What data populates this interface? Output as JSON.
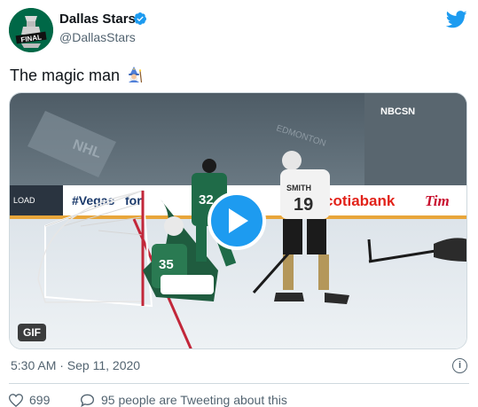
{
  "author": {
    "name": "Dallas Stars",
    "handle": "@DallasStars",
    "avatar_icon": "stanley-cup-final-logo",
    "avatar_text": "FINAL",
    "verified": true
  },
  "tweet": {
    "text": "The magic man",
    "emoji_icon": "wizard-emoji"
  },
  "media": {
    "type": "gif",
    "badge_label": "GIF",
    "broadcaster": "NBCSN",
    "board_ads": [
      "cotiabank",
      "Tim"
    ],
    "ice_text": "EDMONTON",
    "jersey_numbers": [
      "19",
      "32",
      "35"
    ],
    "jersey_name": "SMITH"
  },
  "timestamp": "5:30 AM · Sep 11, 2020",
  "actions": {
    "likes_count": "699",
    "conversation_text": "95 people are Tweeting about this"
  },
  "colors": {
    "accent": "#1d9bf0",
    "stars_green": "#006847"
  }
}
